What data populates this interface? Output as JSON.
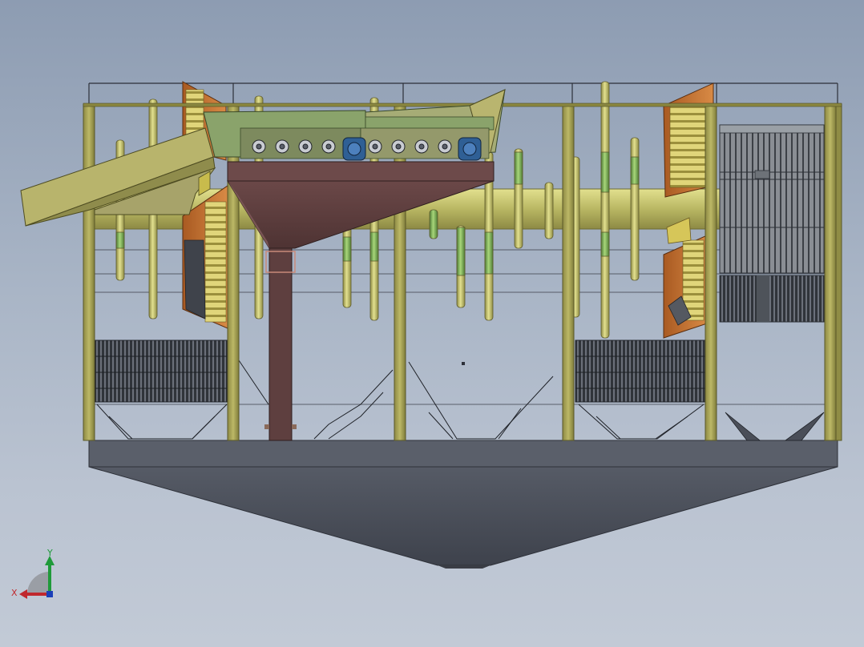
{
  "viewport": {
    "background_top": "#8d9cb2",
    "background_bottom": "#c2cad6"
  },
  "colors": {
    "frame_olive": "#aaa559",
    "frame_olive_dark": "#7f7c3a",
    "hopper_maroon": "#5e3f3f",
    "hopper_maroon_dark": "#4a3030",
    "tank_slate": "#4a4e59",
    "tank_slate_light": "#5a5f6a",
    "pipe_yellow": "#c9c870",
    "pipe_green": "#86b55a",
    "orange_screen": "#c87333",
    "screen_yellow": "#d9cf6a",
    "conveyor_green": "#89a26b",
    "motor_blue": "#2f5f95"
  },
  "triad": {
    "x_label": "X",
    "y_label": "Y",
    "x_color": "#c0282d",
    "y_color": "#1f9a3a",
    "z_color": "#1a3fb8"
  }
}
